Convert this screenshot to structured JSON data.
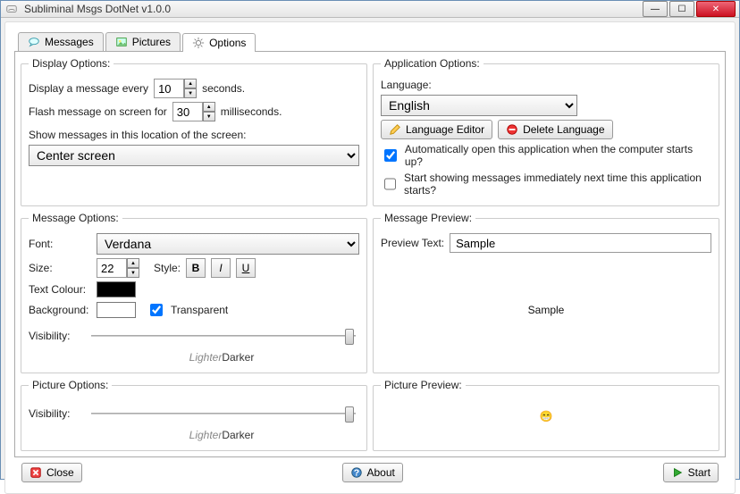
{
  "window": {
    "title": "Subliminal Msgs DotNet v1.0.0"
  },
  "tabs": {
    "messages": "Messages",
    "pictures": "Pictures",
    "options": "Options",
    "active": "options"
  },
  "display": {
    "legend": "Display Options:",
    "every_label_pre": "Display a message every",
    "every_value": "10",
    "every_label_post": "seconds.",
    "flash_label_pre": "Flash message on screen for",
    "flash_value": "30",
    "flash_label_post": "milliseconds.",
    "location_label": "Show messages in this location of the screen:",
    "location_value": "Center screen"
  },
  "app": {
    "legend": "Application Options:",
    "language_label": "Language:",
    "language_value": "English",
    "lang_editor_btn": "Language Editor",
    "del_lang_btn": "Delete Language",
    "autostart_label": "Automatically open this application when the computer starts up?",
    "autostart_checked": true,
    "start_showing_label": "Start showing messages immediately next time this application starts?",
    "start_showing_checked": false
  },
  "message": {
    "legend": "Message Options:",
    "font_label": "Font:",
    "font_value": "Verdana",
    "size_label": "Size:",
    "size_value": "22",
    "style_label": "Style:",
    "text_colour_label": "Text Colour:",
    "text_colour_value": "#000000",
    "background_label": "Background:",
    "background_value": "#ffffff",
    "transparent_label": "Transparent",
    "transparent_checked": true,
    "visibility_label": "Visibility:",
    "lighter_label": "Lighter",
    "darker_label": "Darker"
  },
  "preview": {
    "legend": "Message Preview:",
    "text_label": "Preview Text:",
    "text_value": "Sample",
    "sample": "Sample"
  },
  "picture": {
    "legend": "Picture Options:",
    "visibility_label": "Visibility:",
    "lighter_label": "Lighter",
    "darker_label": "Darker"
  },
  "picture_preview": {
    "legend": "Picture Preview:"
  },
  "footer": {
    "close": "Close",
    "about": "About",
    "start": "Start"
  }
}
